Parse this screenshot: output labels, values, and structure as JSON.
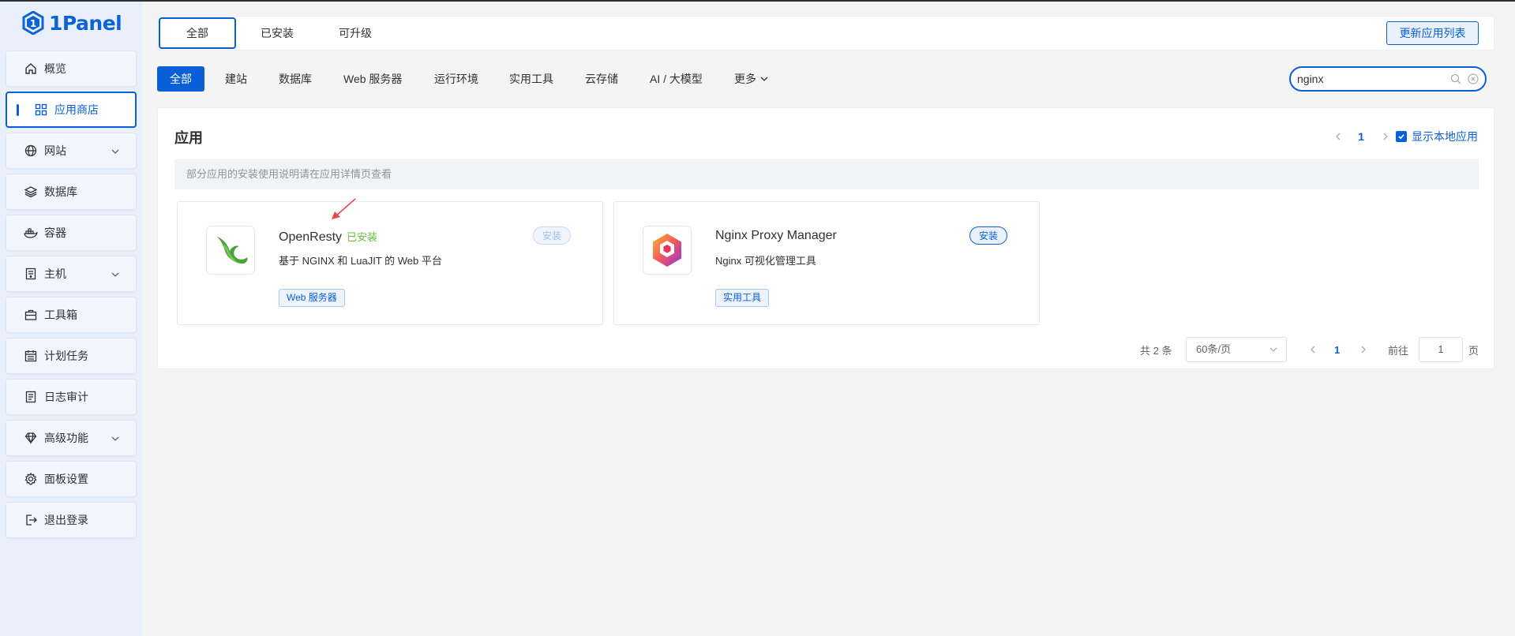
{
  "brand": {
    "name": "1Panel",
    "color": "#0a5fd8"
  },
  "sidebar": {
    "items": [
      {
        "label": "概览",
        "icon": "home-icon"
      },
      {
        "label": "应用商店",
        "icon": "grid-icon",
        "active": true
      },
      {
        "label": "网站",
        "icon": "globe-icon",
        "expandable": true
      },
      {
        "label": "数据库",
        "icon": "layers-icon"
      },
      {
        "label": "容器",
        "icon": "docker-icon"
      },
      {
        "label": "主机",
        "icon": "server-icon",
        "expandable": true
      },
      {
        "label": "工具箱",
        "icon": "toolbox-icon"
      },
      {
        "label": "计划任务",
        "icon": "calendar-icon"
      },
      {
        "label": "日志审计",
        "icon": "log-icon"
      },
      {
        "label": "高级功能",
        "icon": "diamond-icon",
        "expandable": true
      },
      {
        "label": "面板设置",
        "icon": "gear-icon"
      },
      {
        "label": "退出登录",
        "icon": "logout-icon"
      }
    ]
  },
  "tabs": {
    "all": "全部",
    "installed": "已安装",
    "upgradable": "可升级",
    "update_button": "更新应用列表"
  },
  "categories": {
    "items": [
      "全部",
      "建站",
      "数据库",
      "Web 服务器",
      "运行环境",
      "实用工具",
      "云存储",
      "AI / 大模型"
    ],
    "more": "更多"
  },
  "search": {
    "value": "nginx",
    "placeholder": ""
  },
  "panel": {
    "title": "应用",
    "top_page": "1",
    "show_local_label": "显示本地应用",
    "show_local_checked": true,
    "notice": "部分应用的安装使用说明请在应用详情页查看"
  },
  "apps": [
    {
      "name": "OpenResty",
      "installed_label": "已安装",
      "description": "基于 NGINX 和 LuaJIT 的 Web 平台",
      "tag": "Web 服务器",
      "install_label": "安装",
      "install_disabled": true
    },
    {
      "name": "Nginx Proxy Manager",
      "installed_label": "",
      "description": "Nginx 可视化管理工具",
      "tag": "实用工具",
      "install_label": "安装",
      "install_disabled": false
    }
  ],
  "pagination": {
    "total": "共 2 条",
    "page_size": "60条/页",
    "current": "1",
    "goto_label": "前往",
    "goto_value": "1",
    "page_suffix": "页"
  }
}
